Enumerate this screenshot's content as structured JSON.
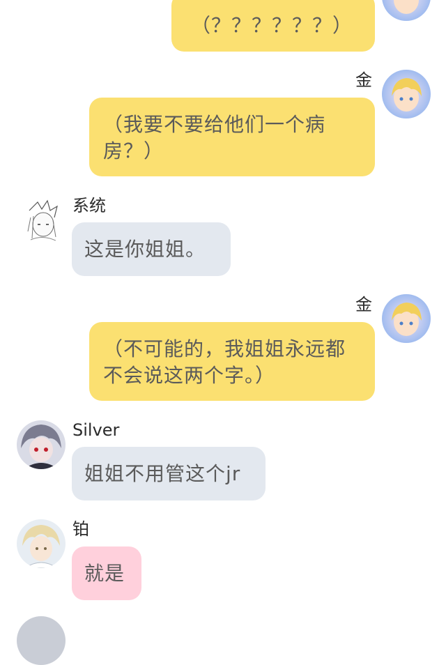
{
  "messages": [
    {
      "side": "right",
      "sender": "",
      "text": "（？？？？？？）",
      "avatar_icon": "blonde-character-avatar-icon",
      "color": "#fbe071"
    },
    {
      "side": "right",
      "sender": "金",
      "text": "（我要不要给他们一个病房？）",
      "avatar_icon": "blonde-character-avatar-icon",
      "color": "#fbe071"
    },
    {
      "side": "left",
      "sender": "系统",
      "text": "这是你姐姐。",
      "avatar_icon": "sketch-character-avatar-icon",
      "color": "#e3e8ef"
    },
    {
      "side": "right",
      "sender": "金",
      "text": "（不可能的，我姐姐永远都不会说这两个字。）",
      "avatar_icon": "blonde-character-avatar-icon",
      "color": "#fbe071"
    },
    {
      "side": "left",
      "sender": "Silver",
      "text": "姐姐不用管这个jr",
      "avatar_icon": "silver-character-avatar-icon",
      "color": "#e3e8ef"
    },
    {
      "side": "left",
      "sender": "铂",
      "text": "就是",
      "avatar_icon": "platinum-character-avatar-icon",
      "color": "#ffd0dc"
    }
  ]
}
